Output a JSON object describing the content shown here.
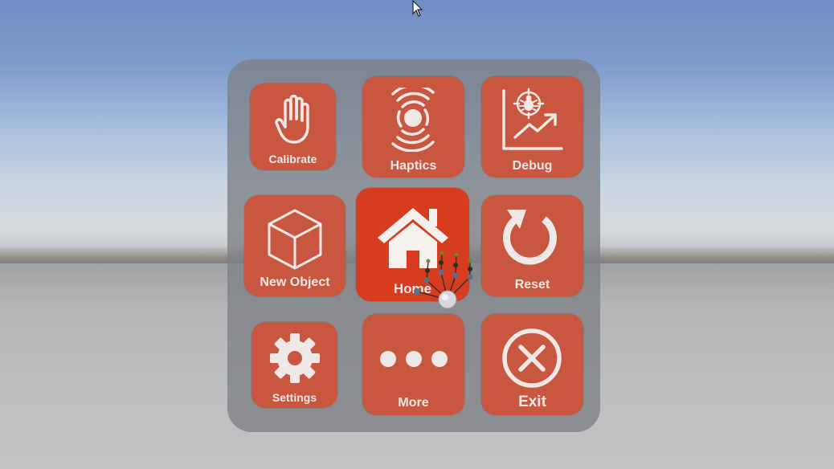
{
  "menu": {
    "tiles": [
      {
        "label": "Calibrate",
        "icon": "hand-icon"
      },
      {
        "label": "Haptics",
        "icon": "haptics-icon"
      },
      {
        "label": "Debug",
        "icon": "debug-chart-icon"
      },
      {
        "label": "New Object",
        "icon": "cube-icon"
      },
      {
        "label": "Home",
        "icon": "home-icon",
        "active": true
      },
      {
        "label": "Reset",
        "icon": "reset-icon"
      },
      {
        "label": "Settings",
        "icon": "gear-icon"
      },
      {
        "label": "More",
        "icon": "more-dots-icon"
      },
      {
        "label": "Exit",
        "icon": "exit-icon"
      }
    ]
  },
  "colors": {
    "tile": "#c9573f",
    "tile_active": "#d63c1d",
    "icon": "#f0e8e6",
    "panel": "#7d8085"
  }
}
